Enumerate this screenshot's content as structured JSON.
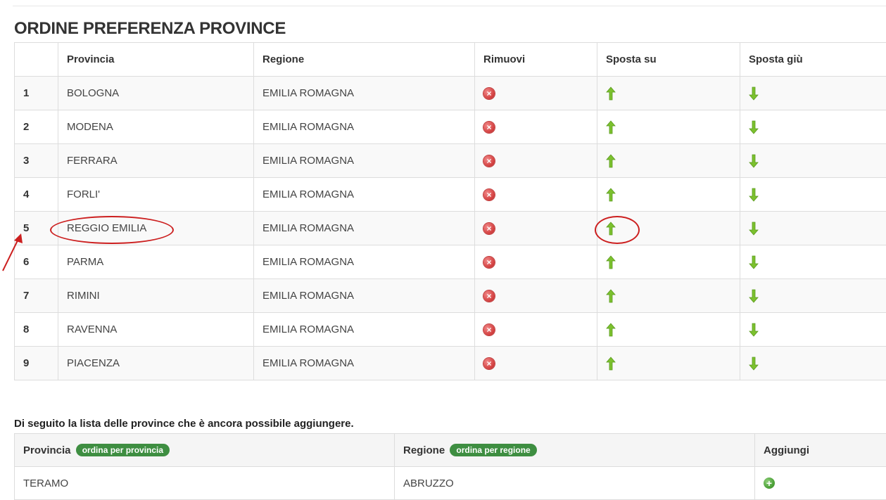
{
  "preference_section": {
    "title": "ORDINE PREFERENZA PROVINCE",
    "headers": {
      "index": "",
      "provincia": "Provincia",
      "regione": "Regione",
      "rimuovi": "Rimuovi",
      "sposta_su": "Sposta su",
      "sposta_giu": "Sposta giù"
    },
    "rows": [
      {
        "index": "1",
        "provincia": "BOLOGNA",
        "regione": "EMILIA ROMAGNA"
      },
      {
        "index": "2",
        "provincia": "MODENA",
        "regione": "EMILIA ROMAGNA"
      },
      {
        "index": "3",
        "provincia": "FERRARA",
        "regione": "EMILIA ROMAGNA"
      },
      {
        "index": "4",
        "provincia": "FORLI'",
        "regione": "EMILIA ROMAGNA"
      },
      {
        "index": "5",
        "provincia": "REGGIO EMILIA",
        "regione": "EMILIA ROMAGNA"
      },
      {
        "index": "6",
        "provincia": "PARMA",
        "regione": "EMILIA ROMAGNA"
      },
      {
        "index": "7",
        "provincia": "RIMINI",
        "regione": "EMILIA ROMAGNA"
      },
      {
        "index": "8",
        "provincia": "RAVENNA",
        "regione": "EMILIA ROMAGNA"
      },
      {
        "index": "9",
        "provincia": "PIACENZA",
        "regione": "EMILIA ROMAGNA"
      }
    ],
    "icons": {
      "remove": "remove-circle-icon",
      "move_up": "arrow-up-icon",
      "move_down": "arrow-down-icon"
    }
  },
  "available_section": {
    "caption": "Di seguito la lista delle province che è ancora possibile aggiungere.",
    "headers": {
      "provincia": "Provincia",
      "regione": "Regione",
      "aggiungi": "Aggiungi"
    },
    "sort_badges": {
      "provincia": "ordina per provincia",
      "regione": "ordina per regione"
    },
    "rows": [
      {
        "provincia": "TERAMO",
        "regione": "ABRUZZO"
      }
    ],
    "icons": {
      "add": "add-circle-icon"
    }
  },
  "colors": {
    "remove": "#d64545",
    "arrow": "#7cc12e",
    "badge": "#3e8e41",
    "annotation": "#cc1f1f"
  }
}
